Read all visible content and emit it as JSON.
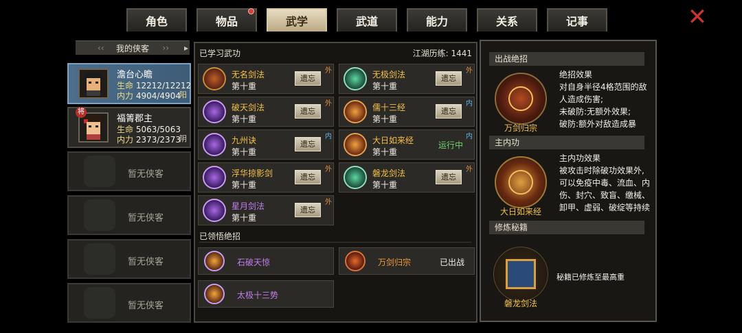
{
  "tabs": [
    {
      "label": "角色"
    },
    {
      "label": "物品",
      "has_dot": true
    },
    {
      "label": "武学",
      "active": true
    },
    {
      "label": "武道"
    },
    {
      "label": "能力"
    },
    {
      "label": "关系"
    },
    {
      "label": "记事"
    }
  ],
  "roster": {
    "title": "我的侠客",
    "heroes": [
      {
        "name": "澹台心瞻",
        "hp_label": "生命",
        "hp": "12212/12212",
        "mp_label": "内力",
        "mp": "4904/4904",
        "yinyang": "阳",
        "selected": true
      },
      {
        "name": "福箐郡主",
        "hp_label": "生命",
        "hp": "5063/5063",
        "mp_label": "内力",
        "mp": "2373/2373",
        "yinyang": "阴",
        "badge": "将"
      }
    ],
    "empty_label": "暂无侠客",
    "empty_slots": 4
  },
  "learned": {
    "title": "已学习武功",
    "exp_label": "江湖历练:",
    "exp_value": "1441",
    "forget_label": "遗忘",
    "skills": [
      {
        "name": "无名剑法",
        "level": "第十重",
        "tag": "外",
        "action": "forget"
      },
      {
        "name": "无极剑法",
        "level": "第十重",
        "tag": "外",
        "action": "forget"
      },
      {
        "name": "破天剑法",
        "level": "第十重",
        "tag": "外",
        "action": "forget"
      },
      {
        "name": "儒十三经",
        "level": "第十重",
        "tag": "内",
        "action": "forget"
      },
      {
        "name": "九州诀",
        "level": "第十重",
        "tag": "内",
        "action": "forget"
      },
      {
        "name": "大日如来经",
        "level": "第十重",
        "tag": "内",
        "action": "running",
        "status": "运行中"
      },
      {
        "name": "浮华掠影剑",
        "level": "第十重",
        "tag": "外",
        "action": "forget"
      },
      {
        "name": "磐龙剑法",
        "level": "第十重",
        "tag": "外",
        "action": "forget"
      },
      {
        "name": "星月剑法",
        "level": "第十重",
        "tag": "外",
        "action": "forget"
      }
    ]
  },
  "comprehended": {
    "title": "已领悟绝招",
    "moves": [
      {
        "name": "石破天惊",
        "status": ""
      },
      {
        "name": "万剑归宗",
        "status": "已出战"
      },
      {
        "name": "太极十三势",
        "status": ""
      }
    ]
  },
  "right": {
    "battle_title": "出战绝招",
    "battle_move": "万剑归宗",
    "battle_effect_title": "绝招效果",
    "battle_effect_text": "对自身半径4格范围的敌人造成伤害;\n未破防:无额外效果;\n破防:额外对敌造成暴",
    "inner_title": "主内功",
    "inner_name": "大日如来经",
    "inner_effect_title": "主内功效果",
    "inner_effect_text": "被攻击时除破功效果外,可以免疫中毒、流血、内伤、封穴、致盲、缴械、卸甲、虚弱、破绽等持续",
    "manual_title": "修炼秘籍",
    "manual_name": "磐龙剑法",
    "manual_status": "秘籍已修炼至最高重"
  }
}
